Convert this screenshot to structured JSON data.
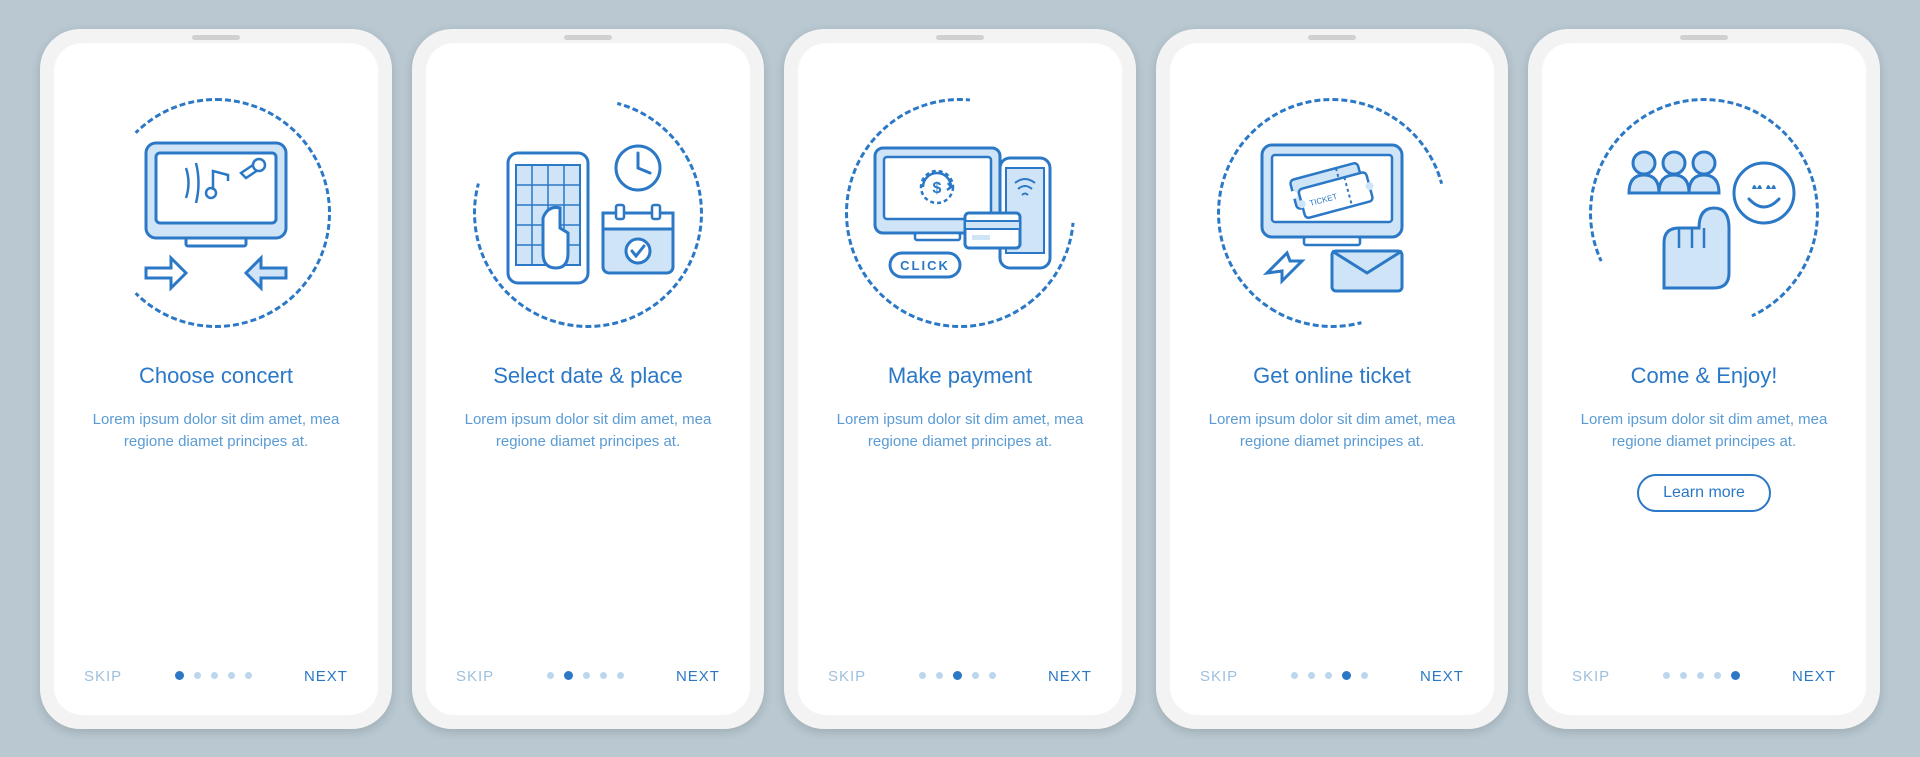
{
  "common": {
    "skip_label": "SKIP",
    "next_label": "NEXT",
    "total_steps": 5
  },
  "screens": [
    {
      "icon_name": "choose-concert-icon",
      "title": "Choose concert",
      "description": "Lorem ipsum dolor sit dim amet, mea regione diamet principes at.",
      "active_step": 1,
      "has_cta": false
    },
    {
      "icon_name": "select-date-place-icon",
      "title": "Select date & place",
      "description": "Lorem ipsum dolor sit dim amet, mea regione diamet principes at.",
      "active_step": 2,
      "has_cta": false
    },
    {
      "icon_name": "make-payment-icon",
      "title": "Make payment",
      "description": "Lorem ipsum dolor sit dim amet, mea regione diamet principes at.",
      "active_step": 3,
      "has_cta": false
    },
    {
      "icon_name": "get-online-ticket-icon",
      "title": "Get online ticket",
      "description": "Lorem ipsum dolor sit dim amet, mea regione diamet principes at.",
      "active_step": 4,
      "has_cta": false
    },
    {
      "icon_name": "come-enjoy-icon",
      "title": "Come & Enjoy!",
      "description": "Lorem ipsum dolor sit dim amet, mea regione diamet principes at.",
      "active_step": 5,
      "has_cta": true,
      "cta_label": "Learn more"
    }
  ],
  "colors": {
    "primary": "#2b78c6",
    "light": "#bcd6ee",
    "fill": "#cfe4f6",
    "bg": "#b9c8d1"
  }
}
